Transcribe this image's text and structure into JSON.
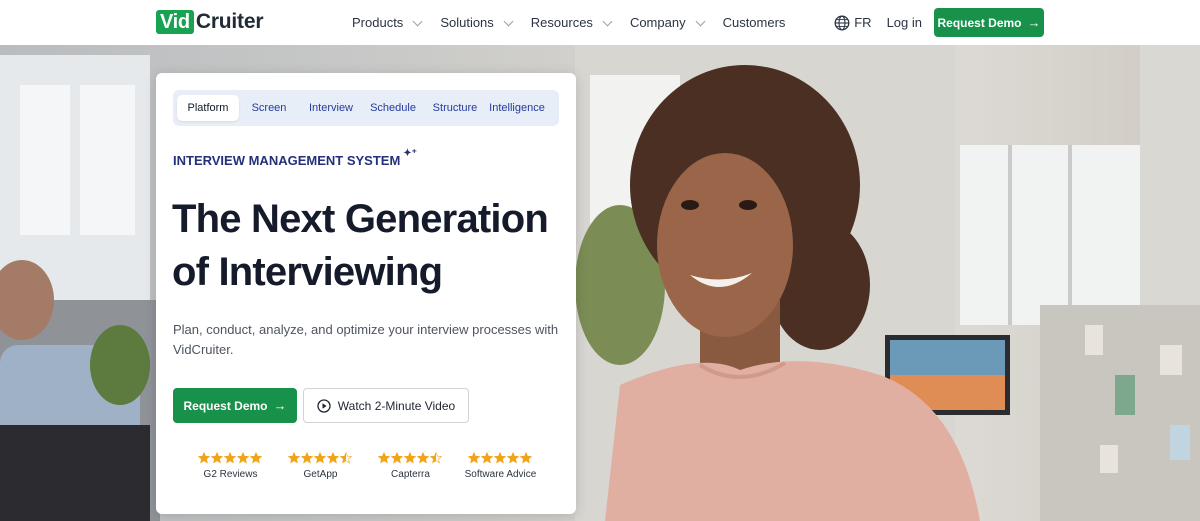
{
  "nav": {
    "logo": {
      "boxed": "Vid",
      "rest": "Cruiter"
    },
    "menu": [
      {
        "label": "Products",
        "has_dropdown": true
      },
      {
        "label": "Solutions",
        "has_dropdown": true
      },
      {
        "label": "Resources",
        "has_dropdown": true
      },
      {
        "label": "Company",
        "has_dropdown": true
      },
      {
        "label": "Customers",
        "has_dropdown": false
      }
    ],
    "language": "FR",
    "login": "Log in",
    "cta": "Request Demo"
  },
  "hero": {
    "tabs": [
      {
        "label": "Platform",
        "active": true
      },
      {
        "label": "Screen",
        "active": false
      },
      {
        "label": "Interview",
        "active": false
      },
      {
        "label": "Schedule",
        "active": false
      },
      {
        "label": "Structure",
        "active": false
      },
      {
        "label": "Intelligence",
        "active": false
      }
    ],
    "eyebrow": "INTERVIEW MANAGEMENT SYSTEM",
    "headline_line1": "The Next Generation",
    "headline_line2": "of Interviewing",
    "description": "Plan, conduct, analyze, and optimize your interview processes with VidCruiter.",
    "primary_cta": "Request Demo",
    "secondary_cta": "Watch 2-Minute Video",
    "ratings": [
      {
        "source": "G2 Reviews",
        "stars": 5
      },
      {
        "source": "GetApp",
        "stars": 4.5
      },
      {
        "source": "Capterra",
        "stars": 4.5
      },
      {
        "source": "Software Advice",
        "stars": 5
      }
    ]
  },
  "colors": {
    "brand_green": "#18924b",
    "logo_green": "#17a351",
    "navy": "#24307a",
    "star": "#f2a418",
    "tab_bg": "#e8eef7"
  },
  "icons": {
    "globe": "globe-icon",
    "arrow": "arrow-right-icon",
    "play": "play-circle-icon",
    "star": "star-icon",
    "sparkle": "sparkle-icon"
  }
}
